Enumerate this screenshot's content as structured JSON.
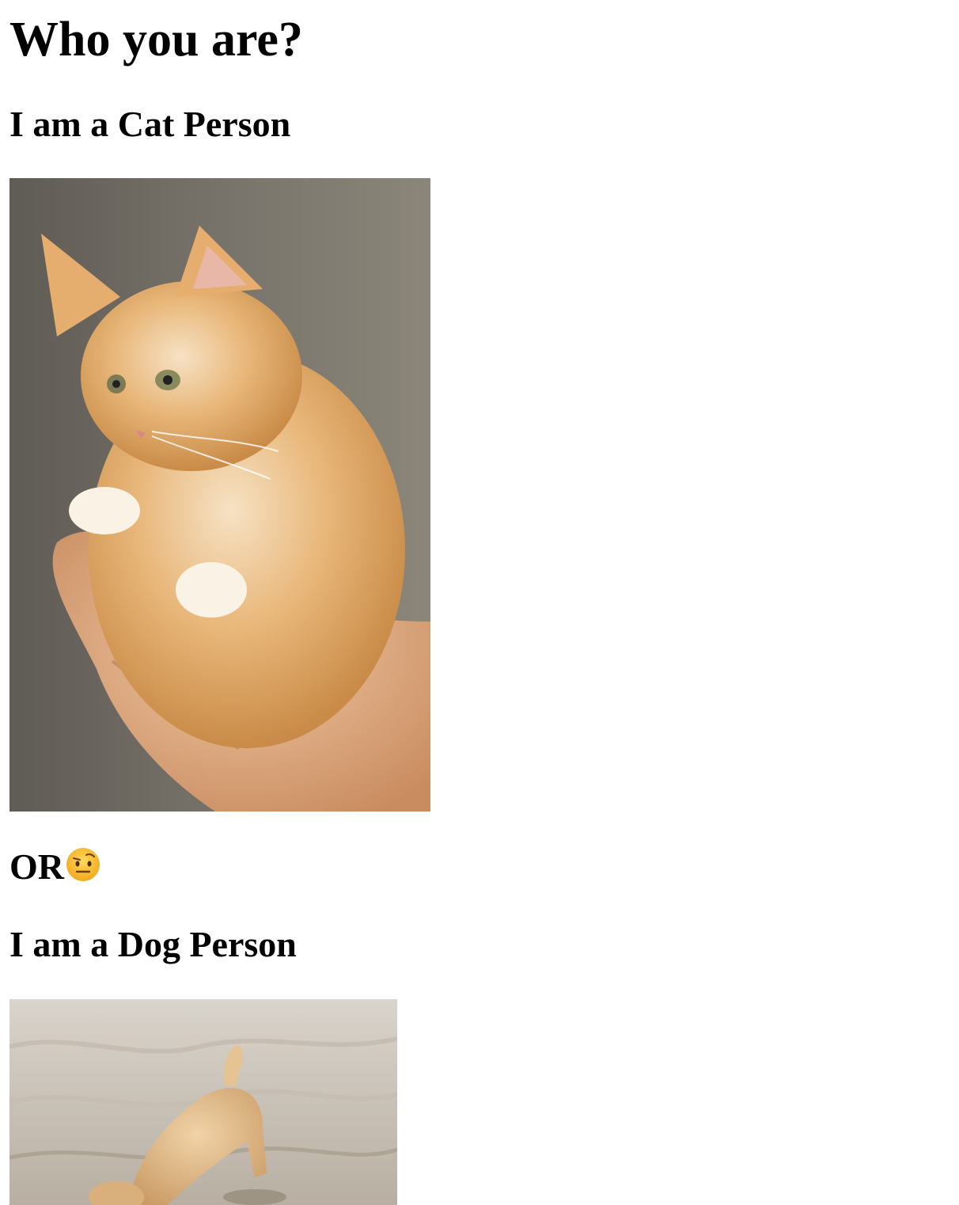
{
  "page": {
    "title": "Who you are?",
    "cat_heading": "I am a Cat Person",
    "or_text": "OR",
    "or_emoji": "face-with-raised-eyebrow",
    "dog_heading": "I am a Dog Person"
  },
  "images": {
    "cat": {
      "subject": "kitten-held-in-hand"
    },
    "dog": {
      "subject": "dog-digging-in-sand"
    }
  }
}
